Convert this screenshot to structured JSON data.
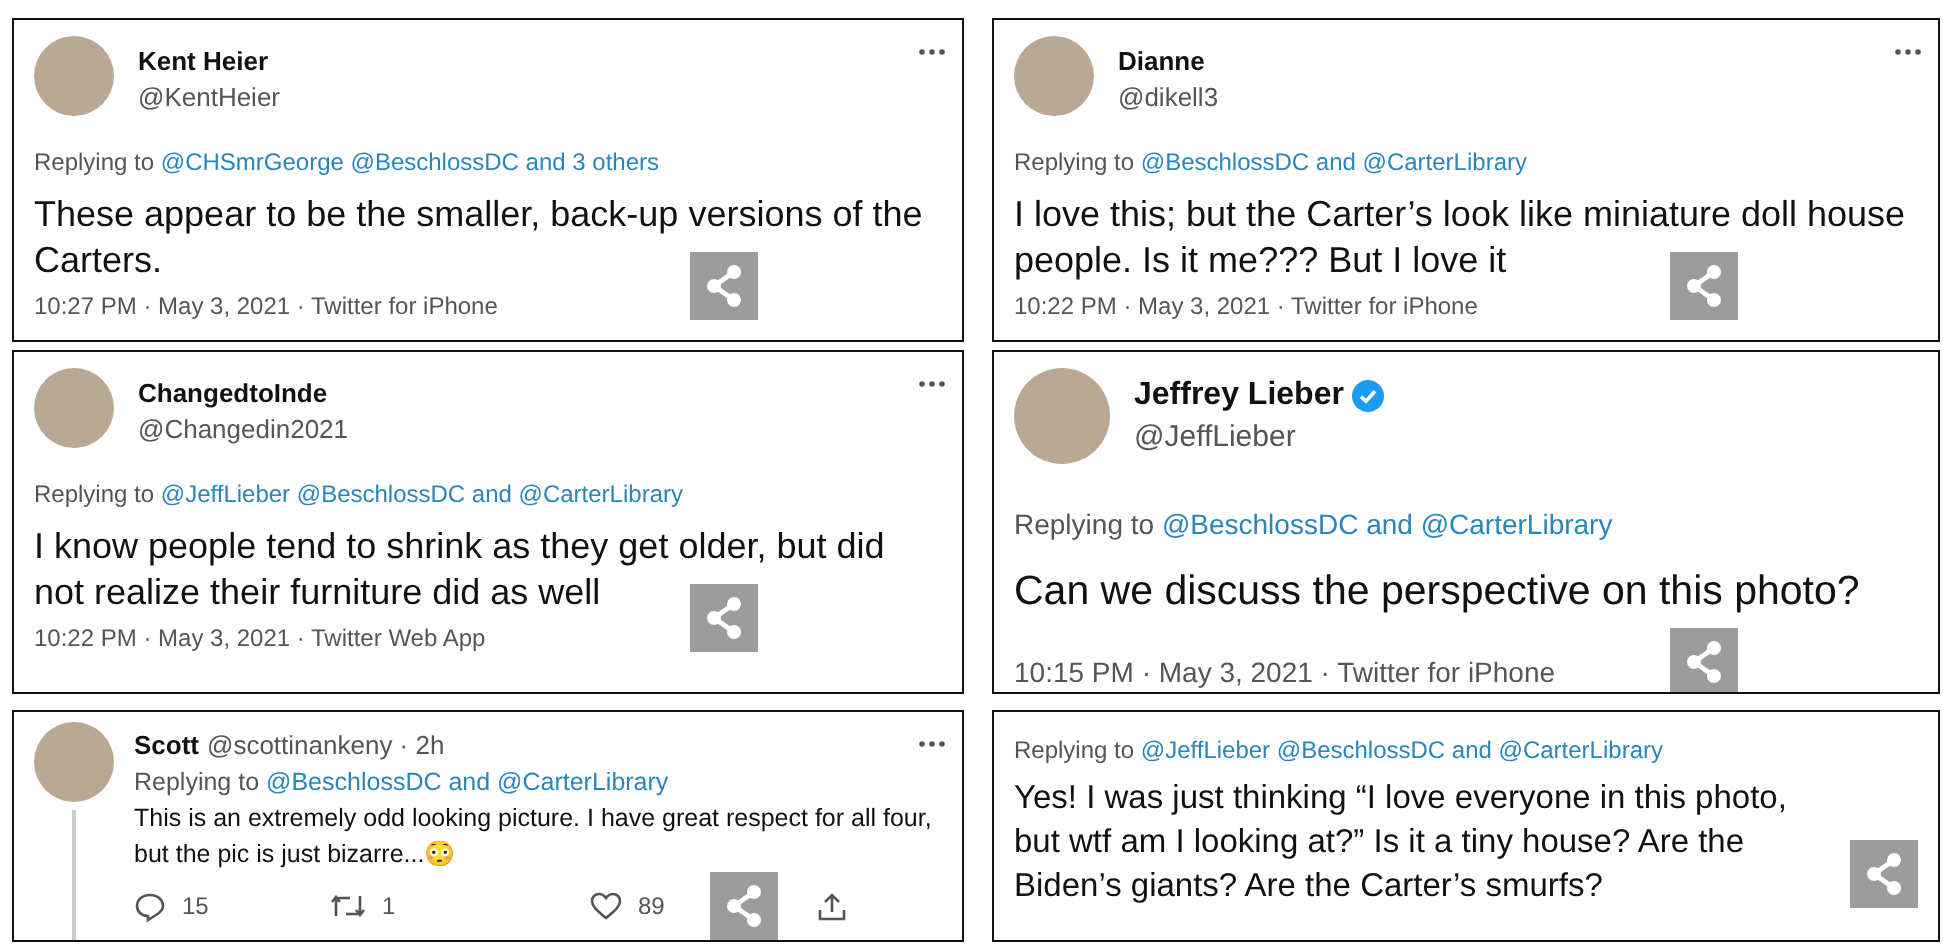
{
  "tweets": [
    {
      "kind": "full",
      "name": "Kent Heier",
      "handle": "@KentHeier",
      "verified": false,
      "reply_prefix": "Replying to",
      "reply_targets": "@CHSmrGeorge @BeschlossDC and 3 others",
      "text": "These appear to be the smaller, back-up versions of the Carters.",
      "meta": "10:27 PM · May 3, 2021 · Twitter for iPhone"
    },
    {
      "kind": "full",
      "name": "Dianne",
      "handle": "@dikell3",
      "verified": false,
      "reply_prefix": "Replying to",
      "reply_targets": "@BeschlossDC and @CarterLibrary",
      "text": "I love this; but the Carter’s look like miniature doll house people. Is it me??? But I love it",
      "meta": "10:22 PM · May 3, 2021 · Twitter for iPhone"
    },
    {
      "kind": "full",
      "name": "ChangedtoInde",
      "handle": "@Changedin2021",
      "verified": false,
      "reply_prefix": "Replying to",
      "reply_targets": "@JeffLieber @BeschlossDC and @CarterLibrary",
      "text": "I know people tend to shrink as they get older, but did not realize their furniture did as well",
      "meta": "10:22 PM · May 3, 2021 · Twitter Web App"
    },
    {
      "kind": "large",
      "name": "Jeffrey Lieber",
      "handle": "@JeffLieber",
      "verified": true,
      "reply_prefix": "Replying to",
      "reply_targets": "@BeschlossDC and @CarterLibrary",
      "text": "Can we discuss the perspective on this photo?",
      "meta": "10:15 PM · May 3, 2021 · Twitter for iPhone"
    },
    {
      "kind": "compact",
      "name": "Scott",
      "handle": "@scottinankeny · 2h",
      "verified": false,
      "reply_prefix": "Replying to",
      "reply_targets": "@BeschlossDC and @CarterLibrary",
      "text": "This is an extremely odd looking picture. I have great respect for all four, but the pic is just bizarre...😳",
      "replies": "15",
      "retweets": "1",
      "likes": "89"
    },
    {
      "kind": "reply",
      "reply_prefix": "Replying to",
      "reply_targets": "@JeffLieber @BeschlossDC and @CarterLibrary",
      "text": "Yes! I was just thinking “I love everyone in this photo, but wtf am I looking at?” Is it a tiny house? Are the Biden’s giants? Are the Carter’s smurfs?"
    }
  ]
}
